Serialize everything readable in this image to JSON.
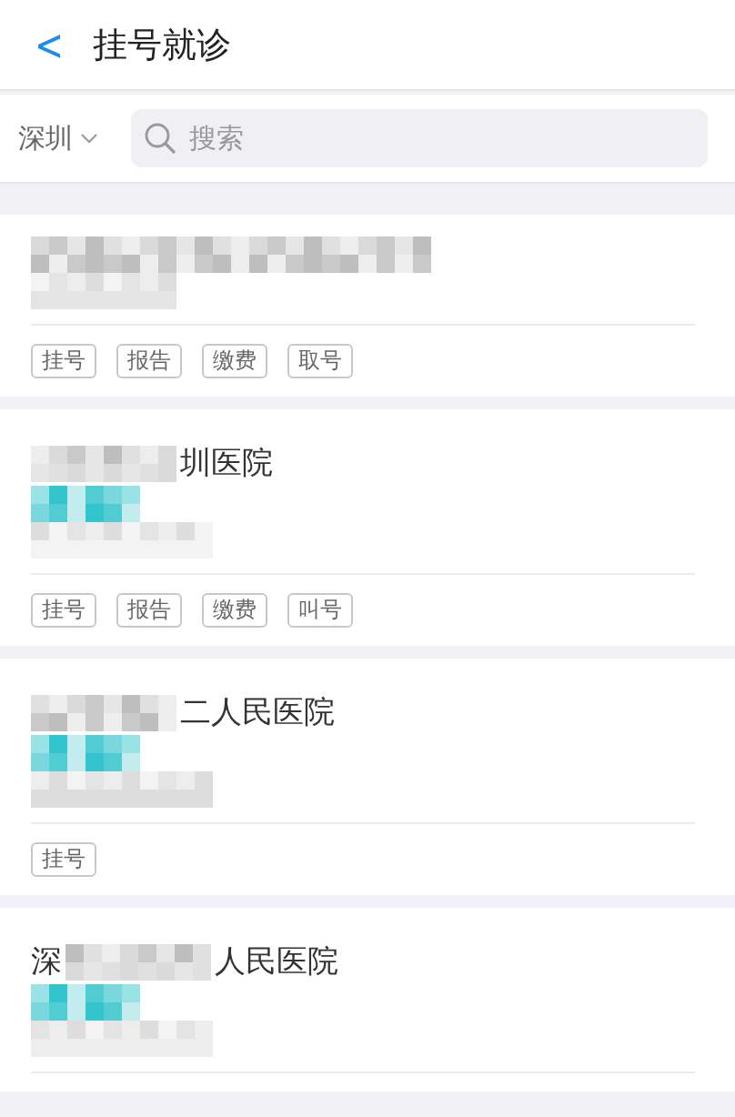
{
  "header": {
    "back": "<",
    "title": "挂号就诊"
  },
  "filter": {
    "city": "深圳",
    "search": {
      "placeholder": "搜索"
    }
  },
  "hospitals": [
    {
      "has_badge": false,
      "tags": [
        "挂号",
        "报告",
        "缴费",
        "取号"
      ]
    },
    {
      "name_end": "圳医院",
      "has_badge": true,
      "tags": [
        "挂号",
        "报告",
        "缴费",
        "叫号"
      ]
    },
    {
      "name_end": "二人民医院",
      "has_badge": true,
      "tags": [
        "挂号"
      ]
    },
    {
      "name_start": "深",
      "name_end": "人民医院",
      "has_badge": true
    }
  ]
}
